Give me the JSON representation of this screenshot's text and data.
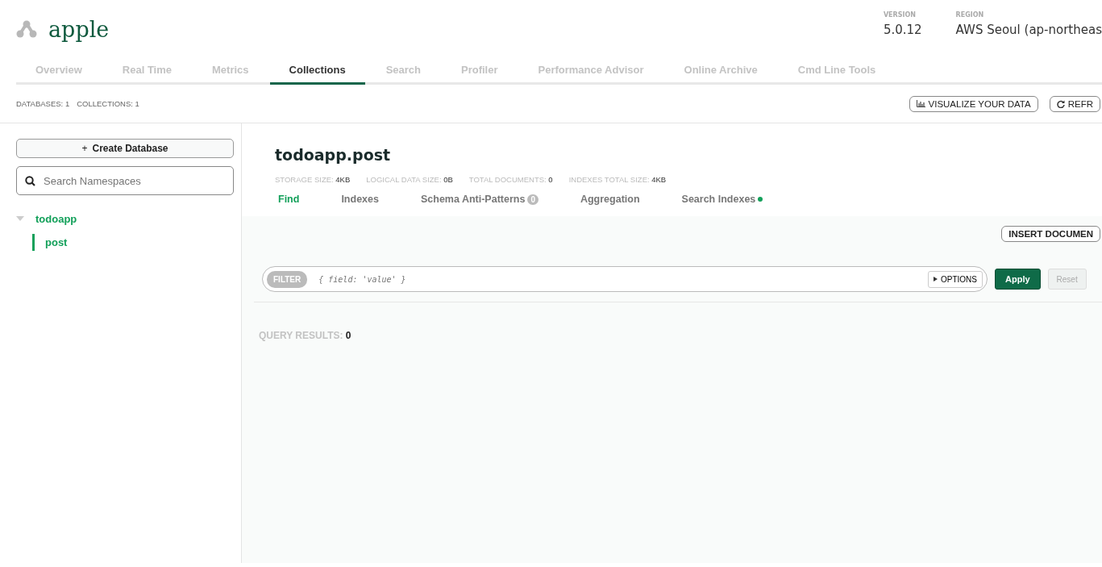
{
  "header": {
    "title": "apple",
    "version_label": "VERSION",
    "version": "5.0.12",
    "region_label": "REGION",
    "region": "AWS Seoul (ap-northeas"
  },
  "tabs": [
    {
      "label": "Overview",
      "selected": false
    },
    {
      "label": "Real Time",
      "selected": false
    },
    {
      "label": "Metrics",
      "selected": false
    },
    {
      "label": "Collections",
      "selected": true
    },
    {
      "label": "Search",
      "selected": false
    },
    {
      "label": "Profiler",
      "selected": false
    },
    {
      "label": "Performance Advisor",
      "selected": false
    },
    {
      "label": "Online Archive",
      "selected": false
    },
    {
      "label": "Cmd Line Tools",
      "selected": false
    }
  ],
  "summary": [
    {
      "label": "DATABASES:",
      "value": "1"
    },
    {
      "label": "COLLECTIONS:",
      "value": "1"
    }
  ],
  "toolbar": {
    "visualize": "VISUALIZE YOUR DATA",
    "refresh": "REFR"
  },
  "sidebar": {
    "create": "Create Database",
    "create_icon": "+",
    "search": {
      "placeholder": "Search Namespaces"
    },
    "tree": [
      {
        "label": "todoapp",
        "expanded": true,
        "children": [
          {
            "label": "post",
            "selected": true
          }
        ]
      }
    ]
  },
  "collection": {
    "title": "todoapp.post",
    "stats": [
      {
        "label": "STORAGE SIZE:",
        "value": "4KB"
      },
      {
        "label": "LOGICAL DATA SIZE:",
        "value": "0B"
      },
      {
        "label": "TOTAL DOCUMENTS:",
        "value": "0"
      },
      {
        "label": "INDEXES TOTAL SIZE:",
        "value": "4KB"
      }
    ],
    "subtabs": [
      {
        "label": "Find",
        "selected": true
      },
      {
        "label": "Indexes",
        "selected": false
      },
      {
        "label": "Schema Anti-Patterns",
        "selected": false,
        "badge": "0"
      },
      {
        "label": "Aggregation",
        "selected": false
      },
      {
        "label": "Search Indexes",
        "selected": false,
        "dot": true
      }
    ],
    "insert": "INSERT DOCUMEN",
    "filter": {
      "tag": "FILTER",
      "placeholder": "{ field: 'value' }",
      "options": "OPTIONS"
    },
    "apply": "Apply",
    "reset": "Reset",
    "results_label": "QUERY RESULTS:",
    "results_value": "0"
  }
}
